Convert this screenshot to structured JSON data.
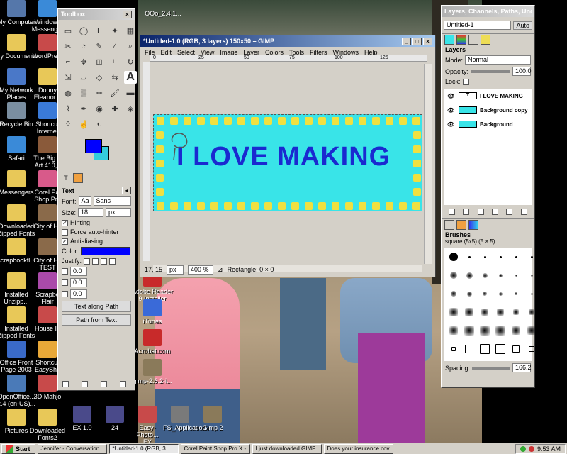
{
  "desktop": {
    "icons_left": [
      {
        "label": "My Computer",
        "color": "#5577aa"
      },
      {
        "label": "My Documents",
        "color": "#e8c858"
      },
      {
        "label": "My Network\nPlaces",
        "color": "#4a78c8"
      },
      {
        "label": "Recycle Bin",
        "color": "#7a8ea0"
      },
      {
        "label": "Safari",
        "color": "#3a8ad8"
      },
      {
        "label": "Messengers",
        "color": "#e8c858"
      },
      {
        "label": "Downloaded\nZipped Fonts",
        "color": "#e8c858"
      },
      {
        "label": "scrapbookfl...",
        "color": "#e8c858"
      },
      {
        "label": "Installed\nUnzipp...",
        "color": "#e8c858"
      },
      {
        "label": "Installed\nZipped Fonts",
        "color": "#e8c858"
      },
      {
        "label": "Office Front\nPage 2003",
        "color": "#3a6ac8"
      },
      {
        "label": "OpenOffice...\n2.4 (en-US)...",
        "color": "#4a7ab8"
      },
      {
        "label": "Pictures",
        "color": "#e8c858"
      }
    ],
    "icons_mid": [
      {
        "label": "Windows\nMessenger",
        "color": "#3a8ad8"
      },
      {
        "label": "WordPre...",
        "color": "#c84a4a"
      },
      {
        "label": "Donny\nEleanor a",
        "color": "#e8c858"
      },
      {
        "label": "Shortcut\nInternet",
        "color": "#3a7ad8"
      },
      {
        "label": "The Big B\nArt 410,0",
        "color": "#8a5a3a"
      },
      {
        "label": "Corel Pai\nShop Pro",
        "color": "#d85a8a"
      },
      {
        "label": "City of He",
        "color": "#8a6a4a"
      },
      {
        "label": "City of He\nTEST",
        "color": "#8a6a4a"
      },
      {
        "label": "Scrapbo\nFlair",
        "color": "#aa4aaa"
      },
      {
        "label": "House In",
        "color": "#c84a4a"
      },
      {
        "label": "Shortcut\nEasySha",
        "color": "#e8a838"
      },
      {
        "label": "3D Mahjo",
        "color": "#c84a4a"
      },
      {
        "label": "Downloaded\nFonts2",
        "color": "#e8c858"
      }
    ],
    "icons_bottom": [
      {
        "label": "EX 1.0",
        "color": "#4a4a8a"
      },
      {
        "label": "24",
        "color": "#4a4a8a"
      },
      {
        "label": "Easy-Photo...\nEX",
        "color": "#c84a4a"
      },
      {
        "label": "FS_Application",
        "color": "#7a7a7a"
      },
      {
        "label": "Gimp 2",
        "color": "#8a7a5a"
      }
    ],
    "icons_right": [
      {
        "label": "Adobe Reader\n9 Installer",
        "color": "#c82a2a"
      },
      {
        "label": "iTunes",
        "color": "#3a6ad8"
      },
      {
        "label": "Acrobat.com",
        "color": "#c82a2a"
      },
      {
        "label": "gimp-2.6.2-i...",
        "color": "#8a7a5a"
      }
    ],
    "top_icon_label": "OOo_2.4.1..."
  },
  "toolbox": {
    "title": "Toolbox",
    "tools": [
      "rect-select",
      "ellipse-select",
      "free-select",
      "fuzzy-select",
      "color-select",
      "scissors",
      "foreground-select",
      "paths",
      "color-picker",
      "zoom",
      "measure",
      "move",
      "align",
      "crop",
      "rotate",
      "scale",
      "shear",
      "perspective",
      "flip",
      "text",
      "bucket-fill",
      "blend",
      "pencil",
      "paintbrush",
      "eraser",
      "airbrush",
      "ink",
      "clone",
      "heal",
      "perspective-clone",
      "blur",
      "smudge",
      "dodge-burn"
    ],
    "fg_color": "#0000ff",
    "bg_color": "#33ccdd",
    "options_title": "Text",
    "font_label": "Font:",
    "font_value": "Sans",
    "size_label": "Size:",
    "size_value": "18",
    "size_unit": "px",
    "hinting": "Hinting",
    "force_autohinter": "Force auto-hinter",
    "antialiasing": "Antialiasing",
    "color_label": "Color:",
    "text_color": "#0000ff",
    "justify_label": "Justify:",
    "indent": [
      "0.0",
      "0.0",
      "0.0"
    ],
    "text_along_path": "Text along Path",
    "path_from_text": "Path from Text"
  },
  "image_window": {
    "title": "*Untitled-1.0 (RGB, 3 layers) 150x50 – GIMP",
    "menu": [
      "File",
      "Edit",
      "Select",
      "View",
      "Image",
      "Layer",
      "Colors",
      "Tools",
      "Filters",
      "Windows",
      "Help"
    ],
    "ruler_marks": [
      "0",
      "25",
      "50",
      "75",
      "100",
      "125"
    ],
    "banner_text": "I LOVE MAKING",
    "banner_bg": "#39e4e8",
    "banner_text_color": "#1a2ad0",
    "dot_color": "#f0e040",
    "status_coords": "17, 15",
    "status_unit": "px",
    "status_zoom": "400 %",
    "status_text": "Rectangle: 0 × 0"
  },
  "layers_panel": {
    "title": "Layers, Channels, Paths, Undo - Br...",
    "image_select": "Untitled-1",
    "auto_btn": "Auto",
    "section": "Layers",
    "mode_label": "Mode:",
    "mode_value": "Normal",
    "opacity_label": "Opacity:",
    "opacity_value": "100.0",
    "lock_label": "Lock:",
    "layers": [
      {
        "name": "I LOVE MAKING",
        "type": "text"
      },
      {
        "name": "Background copy",
        "type": "image"
      },
      {
        "name": "Background",
        "type": "image"
      }
    ],
    "brushes_title": "Brushes",
    "brush_name": "square (5x5) (5 × 5)",
    "spacing_label": "Spacing:",
    "spacing_value": "166.2"
  },
  "taskbar": {
    "start": "Start",
    "tasks": [
      "Jennifer - Conversation",
      "*Untitled-1.0 (RGB, 3 ...",
      "Corel Paint Shop Pro X -...",
      "I just downloaded GIMP ...",
      "Does your insurance cov..."
    ],
    "active_task": 1,
    "clock": "9:53 AM"
  }
}
